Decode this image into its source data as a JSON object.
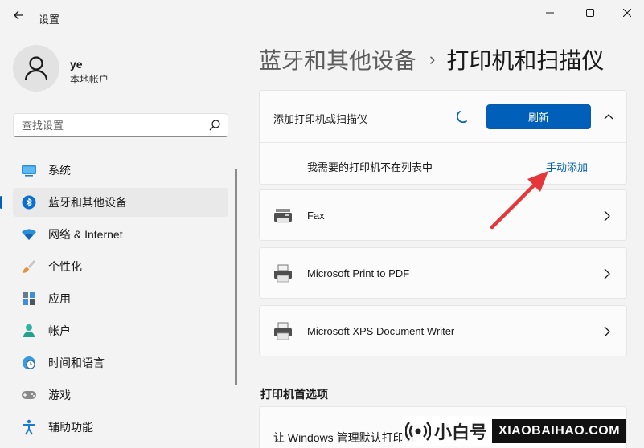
{
  "window": {
    "title": "设置"
  },
  "profile": {
    "name": "ye",
    "account_type": "本地帐户"
  },
  "search": {
    "placeholder": "查找设置"
  },
  "sidebar": {
    "items": [
      {
        "label": "系统",
        "icon": "monitor-icon",
        "active": false
      },
      {
        "label": "蓝牙和其他设备",
        "icon": "bluetooth-icon",
        "active": true
      },
      {
        "label": "网络 & Internet",
        "icon": "wifi-icon",
        "active": false
      },
      {
        "label": "个性化",
        "icon": "brush-icon",
        "active": false
      },
      {
        "label": "应用",
        "icon": "apps-icon",
        "active": false
      },
      {
        "label": "帐户",
        "icon": "person-icon",
        "active": false
      },
      {
        "label": "时间和语言",
        "icon": "globe-clock-icon",
        "active": false
      },
      {
        "label": "游戏",
        "icon": "gamepad-icon",
        "active": false
      },
      {
        "label": "辅助功能",
        "icon": "accessibility-icon",
        "active": false
      }
    ]
  },
  "breadcrumb": {
    "parent": "蓝牙和其他设备",
    "separator": "›",
    "current": "打印机和扫描仪"
  },
  "add_device": {
    "label": "添加打印机或扫描仪",
    "refresh_label": "刷新",
    "manual_prompt": "我需要的打印机不在列表中",
    "manual_link": "手动添加"
  },
  "printers": [
    {
      "name": "Fax",
      "icon": "fax-icon"
    },
    {
      "name": "Microsoft Print to PDF",
      "icon": "printer-icon"
    },
    {
      "name": "Microsoft XPS Document Writer",
      "icon": "printer-icon"
    }
  ],
  "preferences": {
    "heading": "打印机首选项",
    "default_printer_label": "让 Windows 管理默认打印机"
  },
  "watermark": {
    "cn": "小白号",
    "en": "XIAOBAIHAO.COM"
  },
  "colors": {
    "accent": "#005fb8",
    "background": "#f3f3f3",
    "card": "#fbfbfb",
    "arrow": "#e5373a"
  }
}
